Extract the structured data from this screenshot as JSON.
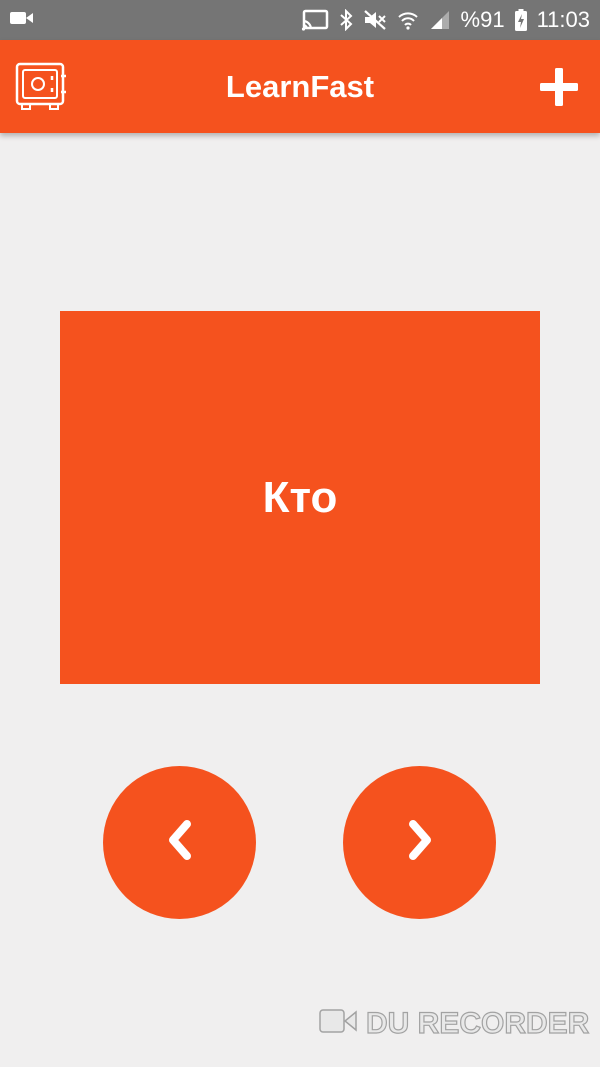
{
  "status_bar": {
    "battery_percent": "%91",
    "time": "11:03",
    "icons": [
      "video-camera-icon",
      "cast-icon",
      "bluetooth-icon",
      "mute-icon",
      "wifi-icon",
      "signal-icon",
      "battery-charging-icon"
    ]
  },
  "app_bar": {
    "title": "LearnFast",
    "left_icon": "safe-icon",
    "right_icon": "plus-icon"
  },
  "card": {
    "word": "Кто"
  },
  "navigation": {
    "prev_icon": "chevron-left-icon",
    "next_icon": "chevron-right-icon"
  },
  "watermark": {
    "text": "DU RECORDER"
  },
  "colors": {
    "accent": "#f5521e",
    "background": "#f0efef",
    "status_bar": "#757575"
  }
}
